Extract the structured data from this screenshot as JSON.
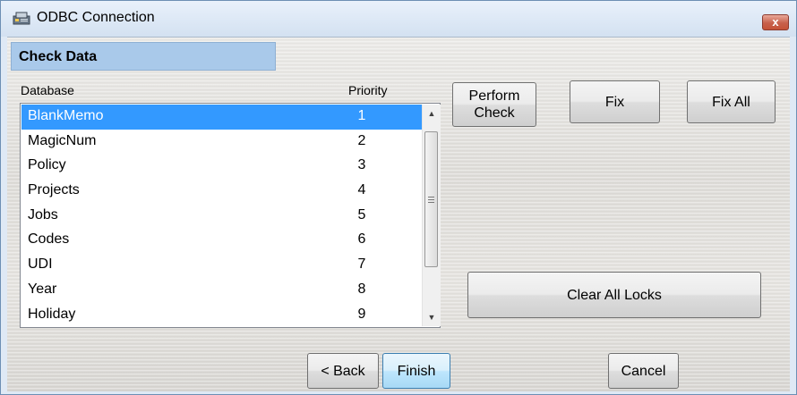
{
  "window": {
    "title": "ODBC Connection",
    "close_glyph": "x",
    "icon": "odbc-app-icon"
  },
  "section": {
    "title": "Check Data"
  },
  "list": {
    "col_database": "Database",
    "col_priority": "Priority",
    "selected_index": 0,
    "rows": [
      {
        "name": "BlankMemo",
        "priority": "1"
      },
      {
        "name": "MagicNum",
        "priority": "2"
      },
      {
        "name": "Policy",
        "priority": "3"
      },
      {
        "name": "Projects",
        "priority": "4"
      },
      {
        "name": "Jobs",
        "priority": "5"
      },
      {
        "name": "Codes",
        "priority": "6"
      },
      {
        "name": "UDI",
        "priority": "7"
      },
      {
        "name": "Year",
        "priority": "8"
      },
      {
        "name": "Holiday",
        "priority": "9"
      }
    ],
    "scroll_up_glyph": "▲",
    "scroll_down_glyph": "▼"
  },
  "buttons": {
    "perform_check_line1": "Perform",
    "perform_check_line2": "Check",
    "fix": "Fix",
    "fix_all": "Fix All",
    "clear_all_locks": "Clear All Locks",
    "back": "< Back",
    "finish": "Finish",
    "cancel": "Cancel"
  },
  "colors": {
    "selection": "#3399ff",
    "section_header": "#a9c9ea",
    "close_button": "#c55237"
  }
}
